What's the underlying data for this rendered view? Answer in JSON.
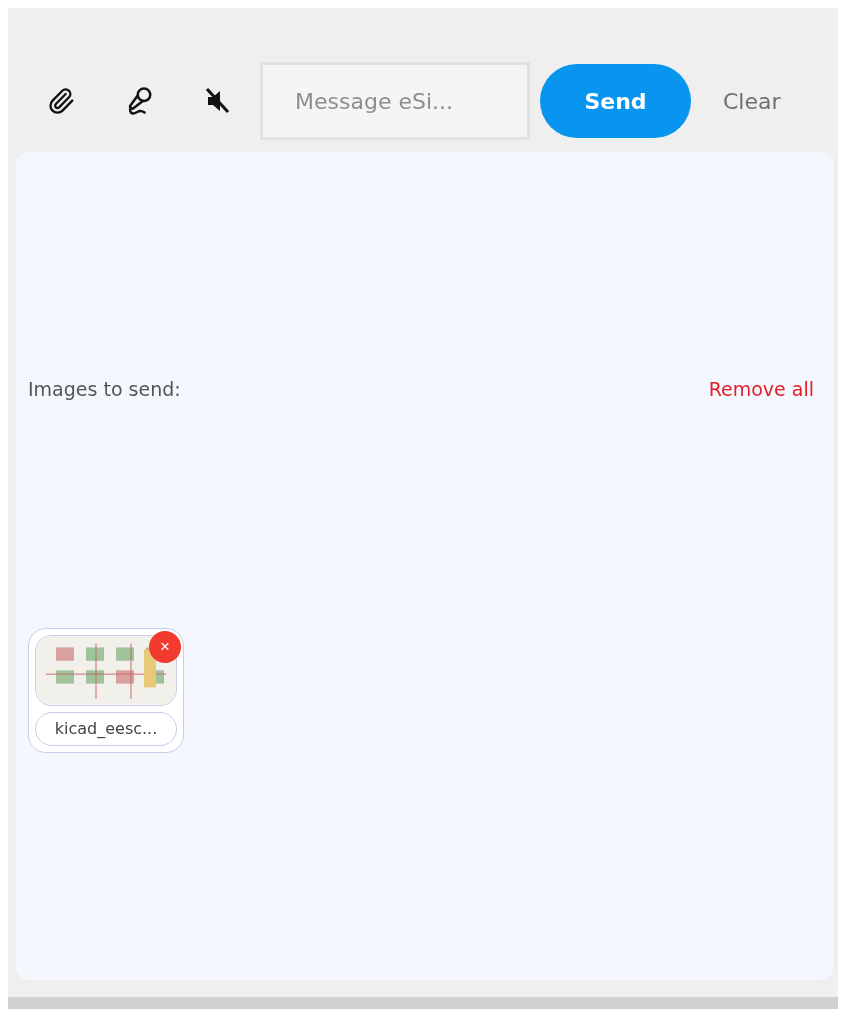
{
  "composer": {
    "placeholder": "Message eSi...",
    "send": "Send",
    "clear": "Clear",
    "muted": true
  },
  "attachments": {
    "label": "Images to send:",
    "remove_all": "Remove all",
    "images": [
      {
        "kind": "picture",
        "filename": "kicad_eesc...",
        "remove": "×"
      }
    ]
  }
}
